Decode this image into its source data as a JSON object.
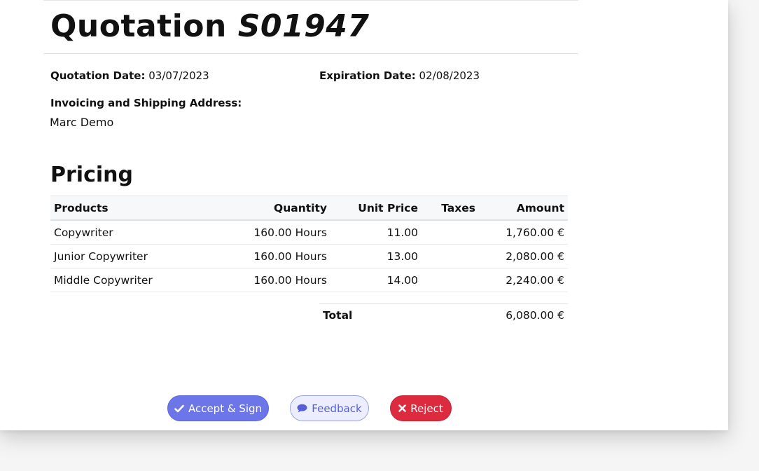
{
  "quotation": {
    "title_prefix": "Quotation",
    "reference": "S01947"
  },
  "meta": {
    "quotation_date_label": "Quotation Date:",
    "quotation_date_value": "03/07/2023",
    "expiration_date_label": "Expiration Date:",
    "expiration_date_value": "02/08/2023",
    "address_label": "Invoicing and Shipping Address:",
    "address_value": "Marc Demo"
  },
  "pricing": {
    "section_title": "Pricing",
    "columns": [
      "Products",
      "Quantity",
      "Unit Price",
      "Taxes",
      "Amount"
    ],
    "rows": [
      {
        "product": "Copywriter",
        "quantity": "160.00 Hours",
        "unit_price": "11.00",
        "taxes": "",
        "amount": "1,760.00 €"
      },
      {
        "product": "Junior Copywriter",
        "quantity": "160.00 Hours",
        "unit_price": "13.00",
        "taxes": "",
        "amount": "2,080.00 €"
      },
      {
        "product": "Middle Copywriter",
        "quantity": "160.00 Hours",
        "unit_price": "14.00",
        "taxes": "",
        "amount": "2,240.00 €"
      }
    ],
    "total_label": "Total",
    "total_value": "6,080.00 €"
  },
  "actions": {
    "accept_label": "Accept & Sign",
    "feedback_label": "Feedback",
    "reject_label": "Reject"
  },
  "icons": {
    "accept": "check-icon",
    "feedback": "comment-icon",
    "reject": "x-icon"
  },
  "colors": {
    "accept_bg": "#6c76e8",
    "feedback_text": "#5660d6",
    "reject_bg": "#dc2a3e"
  }
}
